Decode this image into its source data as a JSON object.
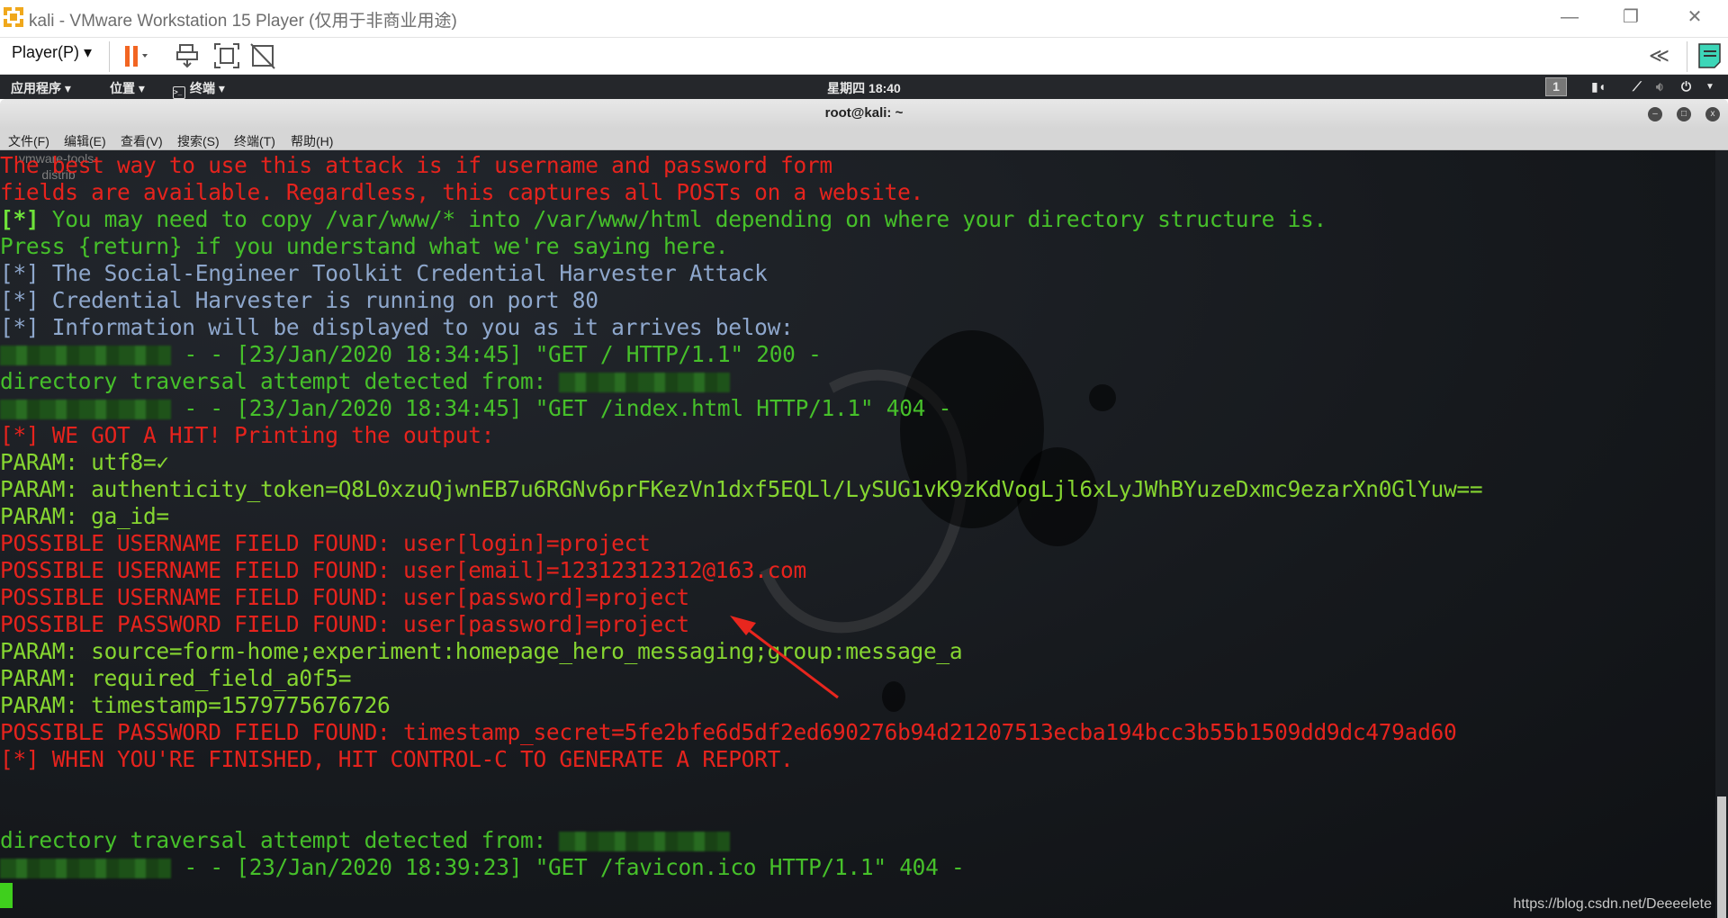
{
  "window": {
    "title": "kali - VMware Workstation 15 Player (仅用于非商业用途)",
    "minimize": "—",
    "restore": "❐",
    "close": "✕"
  },
  "toolbar": {
    "player_menu": "Player(P) ▾",
    "collapse": "≪",
    "icons": [
      "pause-icon",
      "send-ctrl-alt-del-icon",
      "fullscreen-icon",
      "unity-icon",
      "notes-icon"
    ],
    "pause_color": "#f26522",
    "notes_color": "#3dd6b8"
  },
  "kali_panel": {
    "applications": "应用程序 ▾",
    "places": "位置 ▾",
    "terminal": "终端 ▾",
    "clock": "星期四 18:40",
    "workspace": "1"
  },
  "terminal": {
    "title": "root@kali: ~",
    "menu": [
      "文件(F)",
      "编辑(E)",
      "查看(V)",
      "搜索(S)",
      "终端(T)",
      "帮助(H)"
    ],
    "desktop_label": "vmware-tools-distrib",
    "lines": [
      {
        "segments": [
          {
            "t": "The best way to use this attack is if username and password form",
            "c": "red"
          }
        ]
      },
      {
        "segments": [
          {
            "t": "fields are available. Regardless, this captures all POSTs on a website.",
            "c": "red"
          }
        ]
      },
      {
        "segments": [
          {
            "t": "[*]",
            "c": "greenb"
          },
          {
            "t": " You may need to copy /var/www/* into /var/www/html depending on where your directory structure is.",
            "c": "green"
          }
        ]
      },
      {
        "segments": [
          {
            "t": "Press {return} if you understand what we're saying here.",
            "c": "green"
          }
        ]
      },
      {
        "segments": [
          {
            "t": "[*] The Social-Engineer Toolkit Credential Harvester Attack",
            "c": "blue"
          }
        ]
      },
      {
        "segments": [
          {
            "t": "[*] Credential Harvester is running on port 80",
            "c": "blue"
          }
        ]
      },
      {
        "segments": [
          {
            "t": "[*] Information will be displayed to you as it arrives below:",
            "c": "blue"
          }
        ]
      },
      {
        "segments": [
          {
            "redact": true
          },
          {
            "t": " - - [23/Jan/2020 18:34:45] \"GET / HTTP/1.1\" 200 -",
            "c": "green"
          }
        ]
      },
      {
        "segments": [
          {
            "t": "directory traversal attempt detected from: ",
            "c": "green"
          },
          {
            "redact": true
          }
        ]
      },
      {
        "segments": [
          {
            "redact": true
          },
          {
            "t": " - - [23/Jan/2020 18:34:45] \"GET /index.html HTTP/1.1\" 404 -",
            "c": "green"
          }
        ]
      },
      {
        "segments": [
          {
            "t": "[*] WE GOT A HIT! Printing the output:",
            "c": "red"
          }
        ]
      },
      {
        "segments": [
          {
            "t": "PARAM: utf8=✓",
            "c": "lime"
          }
        ]
      },
      {
        "segments": [
          {
            "t": "PARAM: authenticity_token=Q8L0xzuQjwnEB7u6RGNv6prFKezVn1dxf5EQLl/LySUG1vK9zKdVogLjl6xLyJWhBYuzeDxmc9ezarXn0GlYuw==",
            "c": "lime"
          }
        ]
      },
      {
        "segments": [
          {
            "t": "PARAM: ga_id=",
            "c": "lime"
          }
        ]
      },
      {
        "segments": [
          {
            "t": "POSSIBLE USERNAME FIELD FOUND: user[login]=project",
            "c": "red"
          }
        ]
      },
      {
        "segments": [
          {
            "t": "POSSIBLE USERNAME FIELD FOUND: user[email]=12312312312@163.com",
            "c": "red"
          }
        ]
      },
      {
        "segments": [
          {
            "t": "POSSIBLE USERNAME FIELD FOUND: user[password]=project",
            "c": "red"
          }
        ]
      },
      {
        "segments": [
          {
            "t": "POSSIBLE PASSWORD FIELD FOUND: user[password]=project",
            "c": "red"
          }
        ]
      },
      {
        "segments": [
          {
            "t": "PARAM: source=form-home;experiment:homepage_hero_messaging;group:message_a",
            "c": "lime"
          }
        ]
      },
      {
        "segments": [
          {
            "t": "PARAM: required_field_a0f5=",
            "c": "lime"
          }
        ]
      },
      {
        "segments": [
          {
            "t": "PARAM: timestamp=1579775676726",
            "c": "lime"
          }
        ]
      },
      {
        "segments": [
          {
            "t": "POSSIBLE PASSWORD FIELD FOUND: timestamp_secret=5fe2bfe6d5df2ed690276b94d21207513ecba194bcc3b55b1509dd9dc479ad60",
            "c": "red"
          }
        ]
      },
      {
        "segments": [
          {
            "t": "[*] WHEN YOU'RE FINISHED, HIT CONTROL-C TO GENERATE A REPORT.",
            "c": "red"
          }
        ]
      },
      {
        "segments": []
      },
      {
        "segments": []
      },
      {
        "segments": [
          {
            "t": "directory traversal attempt detected from: ",
            "c": "green"
          },
          {
            "redact": true
          }
        ]
      },
      {
        "segments": [
          {
            "redact": true
          },
          {
            "t": " - - [23/Jan/2020 18:39:23] \"GET /favicon.ico HTTP/1.1\" 404 -",
            "c": "green"
          }
        ]
      },
      {
        "segments": [
          {
            "cursor": true
          }
        ]
      }
    ]
  },
  "watermark": "https://blog.csdn.net/Deeeelete",
  "annotation_color": "#e8261e"
}
